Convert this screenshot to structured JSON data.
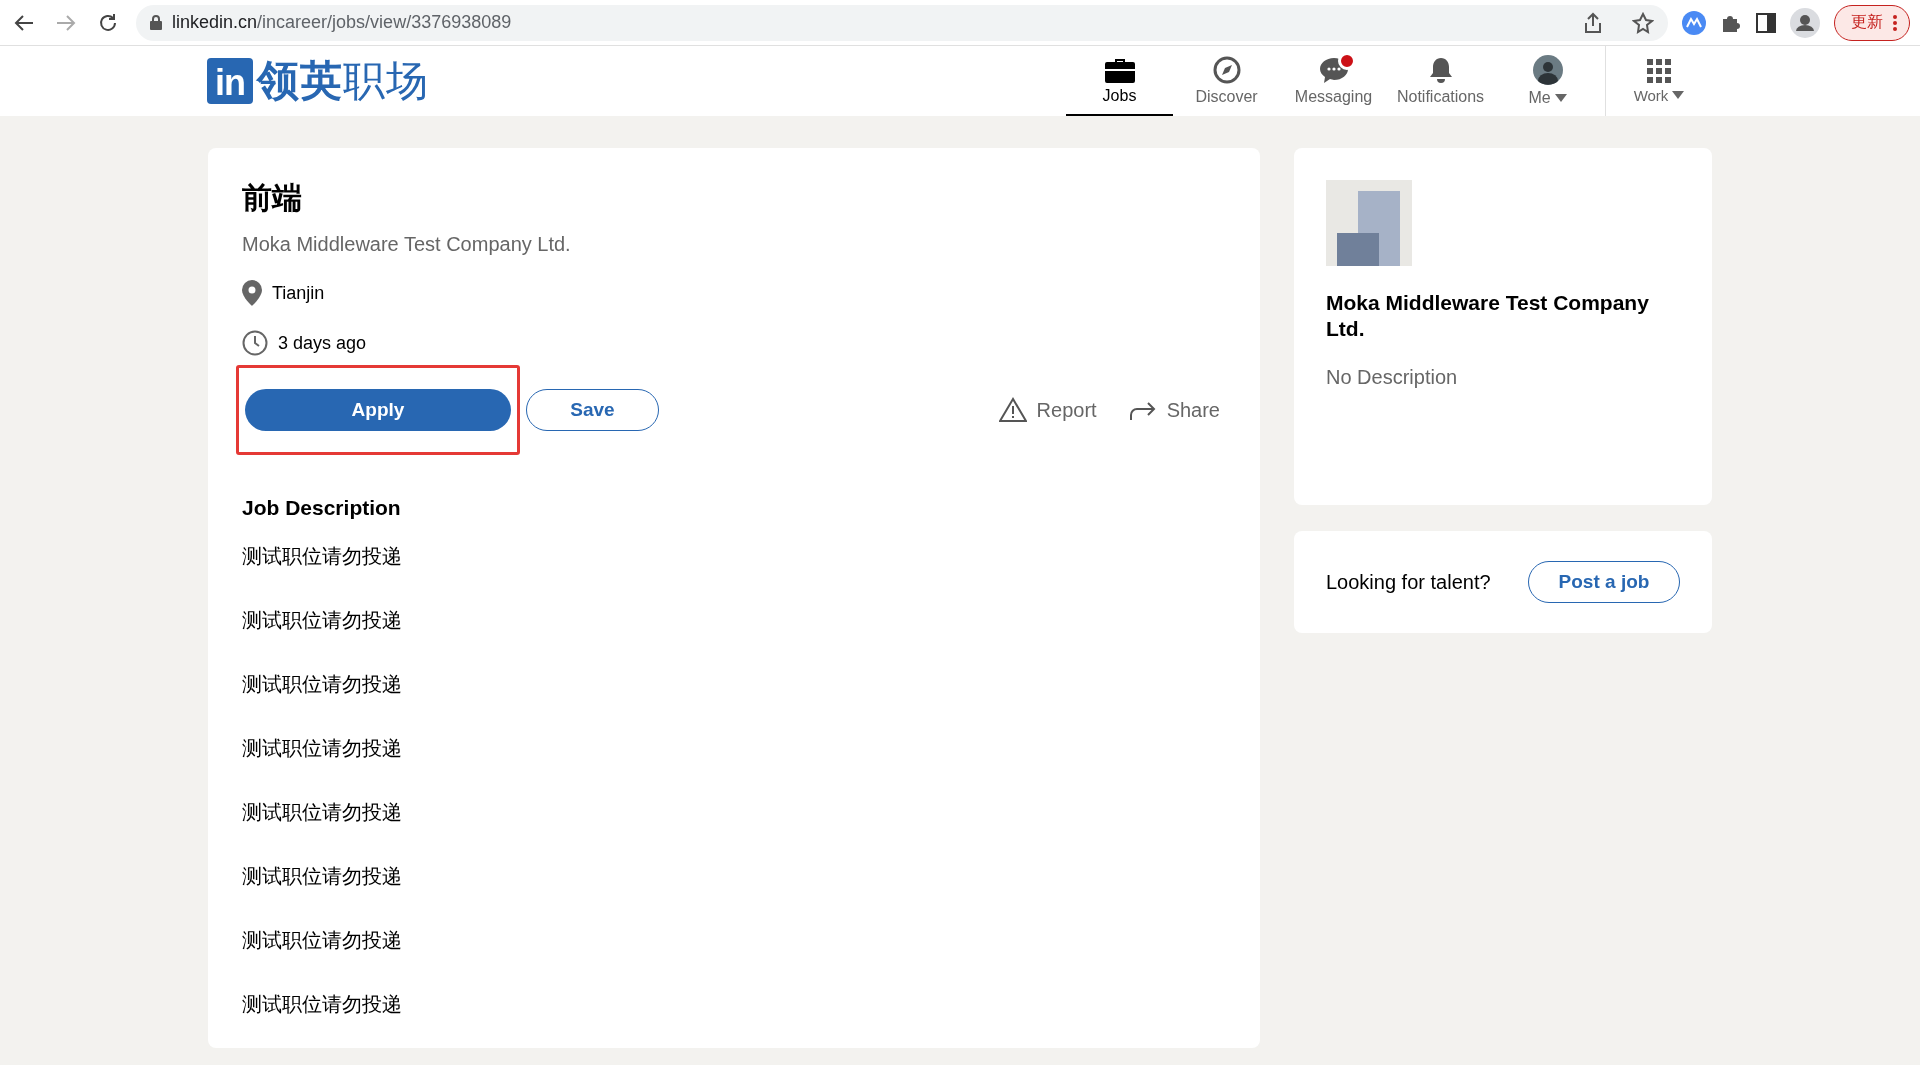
{
  "browser": {
    "url_host": "linkedin.cn",
    "url_path": "/incareer/jobs/view/3376938089",
    "update_button": "更新"
  },
  "logo": {
    "badge": "in",
    "name_bold": "领英",
    "name_light": "职场"
  },
  "nav": [
    {
      "kind": "jobs",
      "label": "Jobs",
      "selected": true,
      "dropdown": false,
      "badge": false
    },
    {
      "kind": "discover",
      "label": "Discover",
      "selected": false,
      "dropdown": false,
      "badge": false
    },
    {
      "kind": "messaging",
      "label": "Messaging",
      "selected": false,
      "dropdown": false,
      "badge": true
    },
    {
      "kind": "notifications",
      "label": "Notifications",
      "selected": false,
      "dropdown": false,
      "badge": false
    },
    {
      "kind": "me",
      "label": "Me",
      "selected": false,
      "dropdown": true,
      "badge": false
    }
  ],
  "work": {
    "label": "Work"
  },
  "job": {
    "title": "前端",
    "company": "Moka Middleware Test Company Ltd.",
    "location": "Tianjin",
    "posted": "3 days ago",
    "apply": {
      "label": "Apply",
      "highlighted": true
    },
    "save": "Save",
    "report": "Report",
    "share": "Share",
    "description_heading": "Job Description",
    "description_lines": [
      "测试职位请勿投递",
      "测试职位请勿投递",
      "测试职位请勿投递",
      "测试职位请勿投递",
      "测试职位请勿投递",
      "测试职位请勿投递",
      "测试职位请勿投递",
      "测试职位请勿投递"
    ]
  },
  "company_card": {
    "name": "Moka Middleware Test Company Ltd.",
    "description": "No Description"
  },
  "talent_card": {
    "text": "Looking for talent?",
    "button": "Post a job"
  }
}
